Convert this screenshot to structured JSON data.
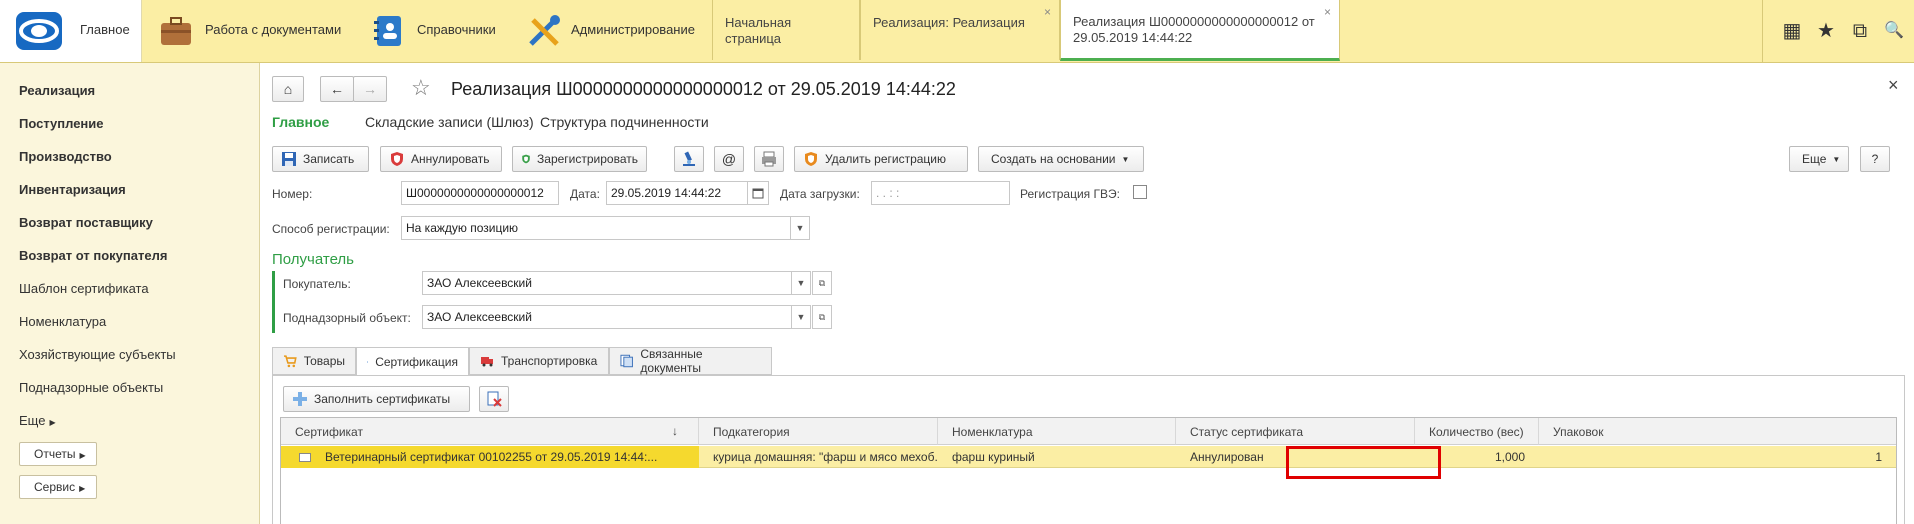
{
  "topbar": {
    "sections": [
      {
        "label": "Главное",
        "icon": "1c-logo"
      },
      {
        "label": "Работа с документами",
        "icon": "briefcase-icon"
      },
      {
        "label": "Справочники",
        "icon": "address-book-icon"
      },
      {
        "label": "Администрирование",
        "icon": "tools-icon"
      }
    ],
    "open_tabs": [
      {
        "label": "Начальная страница"
      },
      {
        "label": "Реализация: Реализация",
        "close": "×"
      },
      {
        "label": "Реализация Ш0000000000000000012 от 29.05.2019 14:44:22",
        "close": "×"
      }
    ],
    "tools": {
      "apps": "▦",
      "favorites": "★",
      "history": "⧉",
      "search": "🔍"
    }
  },
  "sidebar": {
    "items": [
      {
        "label": "Реализация",
        "bold": true
      },
      {
        "label": "Поступление",
        "bold": true
      },
      {
        "label": "Производство",
        "bold": true
      },
      {
        "label": "Инвентаризация",
        "bold": true
      },
      {
        "label": "Возврат поставщику",
        "bold": true
      },
      {
        "label": "Возврат от покупателя",
        "bold": true
      },
      {
        "label": "Шаблон сертификата",
        "bold": false
      },
      {
        "label": "Номенклатура",
        "bold": false
      },
      {
        "label": "Хозяйствующие субъекты",
        "bold": false
      },
      {
        "label": "Поднадзорные объекты",
        "bold": false
      },
      {
        "label": "Еще",
        "bold": false
      }
    ],
    "buttons": [
      {
        "label": "Отчеты"
      },
      {
        "label": "Сервис"
      }
    ]
  },
  "form": {
    "title": "Реализация Ш0000000000000000012 от 29.05.2019 14:44:22",
    "close": "×",
    "nav": [
      "Главное",
      "Складские записи (Шлюз)",
      "Структура подчиненности"
    ],
    "toolbar": {
      "save": "Записать",
      "cancel": "Аннулировать",
      "register": "Зарегистрировать",
      "email": "@",
      "delete_reg": "Удалить регистрацию",
      "create_based": "Создать на основании",
      "more": "Еще",
      "help": "?"
    },
    "fields": {
      "number_label": "Номер:",
      "number_value": "Ш0000000000000000012",
      "date_label": "Дата:",
      "date_value": "29.05.2019 14:44:22",
      "load_date_label": "Дата загрузки:",
      "load_date_value": " .  .       :  :",
      "gvz_label": "Регистрация ГВЭ:",
      "reg_method_label": "Способ регистрации:",
      "reg_method_value": "На каждую позицию",
      "recipient_group": "Получатель",
      "buyer_label": "Покупатель:",
      "buyer_value": "ЗАО  Алексеевский",
      "object_label": "Поднадзорный объект:",
      "object_value": "ЗАО Алексеевский"
    },
    "tabs": [
      {
        "label": "Товары"
      },
      {
        "label": "Сертификация"
      },
      {
        "label": "Транспортировка"
      },
      {
        "label": "Связанные документы"
      }
    ],
    "fill_button": "Заполнить сертификаты",
    "table": {
      "columns": [
        "Сертификат",
        "Подкатегория",
        "Номенклатура",
        "Статус сертификата",
        "Количество (вес)",
        "Упаковок"
      ],
      "sort_indicator": "↓",
      "rows": [
        {
          "certificate": "Ветеринарный сертификат 00102255 от 29.05.2019 14:44:...",
          "subcategory": "курица домашняя: \"фарш и мясо мехоб...",
          "nomenclature": "фарш куриный",
          "status": "Аннулирован",
          "quantity": "1,000",
          "packages": "1"
        }
      ]
    }
  }
}
